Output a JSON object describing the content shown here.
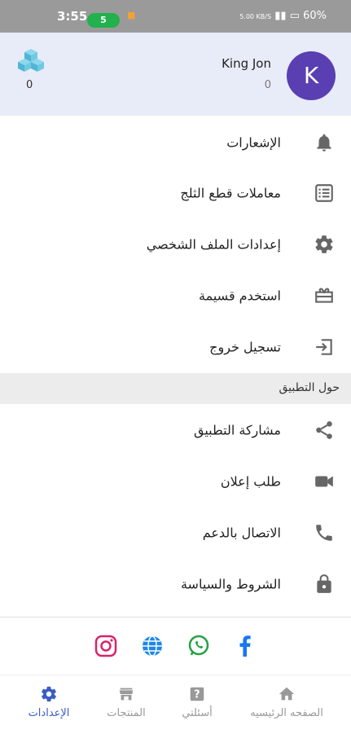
{
  "status_bar": {
    "time": "3:55",
    "pill": "5",
    "battery": "60%",
    "signal": "5.00 KB/S"
  },
  "profile": {
    "avatar_letter": "K",
    "name": "King Jon",
    "points": "0",
    "ice_count": "0"
  },
  "menu": [
    {
      "label": "الإشعارات",
      "icon": "bell-icon"
    },
    {
      "label": "معاملات قطع الثلج",
      "icon": "list-icon"
    },
    {
      "label": "إعدادات الملف الشخصي",
      "icon": "gear-icon"
    },
    {
      "label": "استخدم قسيمة",
      "icon": "ticket-icon"
    },
    {
      "label": "تسجيل خروج",
      "icon": "logout-icon"
    }
  ],
  "about": {
    "title": "حول التطبيق",
    "items": [
      {
        "label": "مشاركة التطبيق",
        "icon": "share-icon"
      },
      {
        "label": "طلب إعلان",
        "icon": "video-icon"
      },
      {
        "label": "الاتصال بالدعم",
        "icon": "phone-icon"
      },
      {
        "label": "الشروط والسياسة",
        "icon": "lock-icon"
      }
    ]
  },
  "social": [
    "instagram-icon",
    "globe-icon",
    "whatsapp-icon",
    "facebook-icon"
  ],
  "nav": [
    {
      "label": "الإعدادات",
      "icon": "gear-icon",
      "active": true
    },
    {
      "label": "المنتجات",
      "icon": "store-icon",
      "active": false
    },
    {
      "label": "أسئلتي",
      "icon": "question-icon",
      "active": false
    },
    {
      "label": "الصفحه الرئيسيه",
      "icon": "home-icon",
      "active": false
    }
  ],
  "colors": {
    "header_bg": "#e8ecf8",
    "avatar": "#5a3fb2",
    "accent": "#3b5cc4",
    "status_pill": "#22b14c"
  }
}
